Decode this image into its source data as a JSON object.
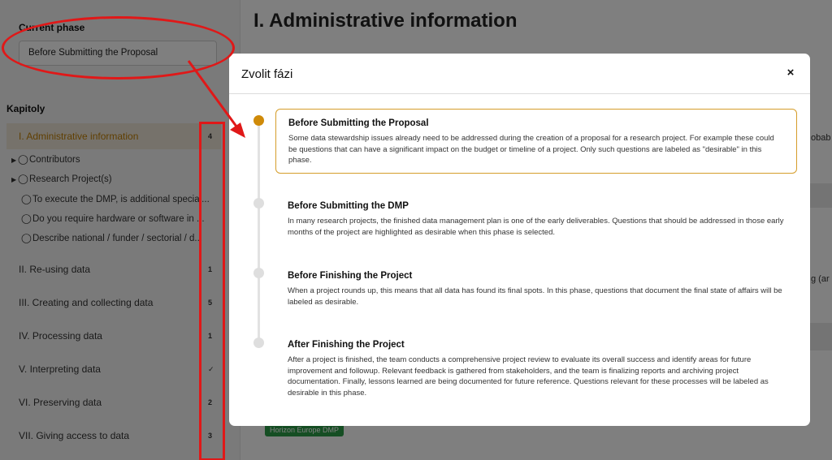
{
  "sidebar": {
    "phase_label": "Current phase",
    "phase_value": "Before Submitting the Proposal",
    "chapters_label": "Kapitoly",
    "chapters": [
      {
        "title": "I. Administrative information",
        "count": "4"
      },
      {
        "title": "II. Re-using data",
        "count": "1"
      },
      {
        "title": "III. Creating and collecting data",
        "count": "5"
      },
      {
        "title": "IV. Processing data",
        "count": "1"
      },
      {
        "title": "V. Interpreting data",
        "count": "✓"
      },
      {
        "title": "VI. Preserving data",
        "count": "2"
      },
      {
        "title": "VII. Giving access to data",
        "count": "3"
      }
    ],
    "sub_items": [
      "Contributors",
      "Research Project(s)",
      "To execute the DMP, is additional special...",
      "Do you require hardware or software in ...",
      "Describe national / funder / sectorial / d..."
    ],
    "caret_glyph": "▶",
    "bubble_glyph": "◯"
  },
  "main": {
    "title": "I. Administrative information",
    "badge": "Horizon Europe DMP",
    "fragment_1": "obab",
    "fragment_2": "g (ar"
  },
  "modal": {
    "title": "Zvolit fázi",
    "close_glyph": "×",
    "phases": [
      {
        "title": "Before Submitting the Proposal",
        "description": "Some data stewardship issues already need to be addressed during the creation of a proposal for a research project. For example these could be questions that can have a significant impact on the budget or timeline of a project. Only such questions are labeled as \"desirable\" in this phase."
      },
      {
        "title": "Before Submitting the DMP",
        "description": "In many research projects, the finished data management plan is one of the early deliverables. Questions that should be addressed in those early months of the project are highlighted as desirable when this phase is selected."
      },
      {
        "title": "Before Finishing the Project",
        "description": "When a project rounds up, this means that all data has found its final spots. In this phase, questions that document the final state of affairs will be labeled as desirable."
      },
      {
        "title": "After Finishing the Project",
        "description": "After a project is finished, the team conducts a comprehensive project review to evaluate its overall success and identify areas for future improvement and followup. Relevant feedback is gathered from stakeholders, and the team is finalizing reports and archiving project documentation. Finally, lessons learned are being documented for future reference. Questions relevant for these processes will be labeled as desirable in this phase."
      }
    ]
  },
  "colors": {
    "accent": "#cf8a09",
    "annotation": "#e01818",
    "badge": "#2a9d46"
  }
}
